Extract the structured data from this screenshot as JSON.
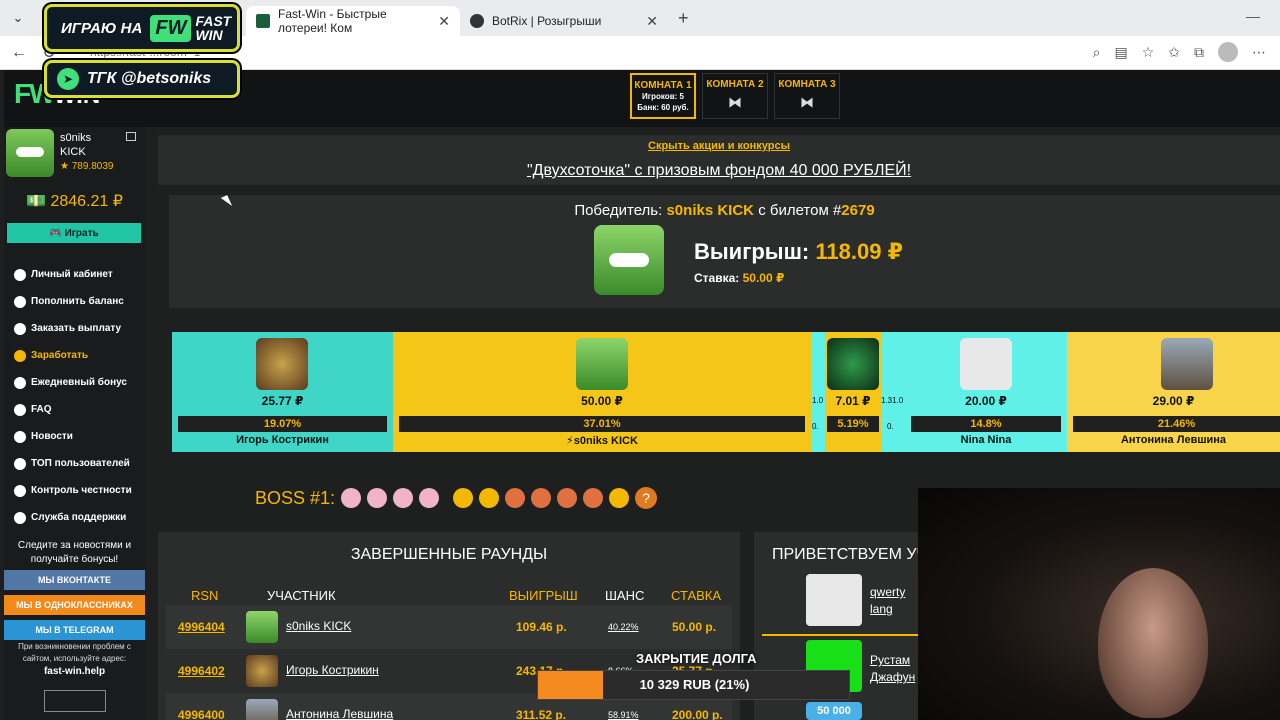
{
  "browser": {
    "tabs": [
      {
        "title": "Fast-Win - Быстрые лотереи! Ком",
        "active": true
      },
      {
        "title": "BotRix | Розыгрыши",
        "active": false
      }
    ],
    "url": "https://fast-win.help/?room=1",
    "url_visible": "https://fast-...room=1"
  },
  "overlay": {
    "promo1": {
      "text": "ИГРАЮ НА",
      "logo_fw": "FW",
      "logo_fast": "FAST",
      "logo_win": "WIN"
    },
    "promo2": {
      "text": "ТГК @betsoniks"
    }
  },
  "header": {
    "logo_fw": "FW",
    "logo_win": "WIN",
    "rooms": [
      {
        "name": "КОМНАТА 1",
        "players": "Игроков: 5",
        "bank": "Банк: 60 руб.",
        "active": true
      },
      {
        "name": "КОМНАТА 2",
        "icon": "ribbon-icon",
        "active": false
      },
      {
        "name": "КОМНАТА 3",
        "icon": "ribbon-icon",
        "active": false
      }
    ]
  },
  "sidebar": {
    "username_line1": "s0niks",
    "username_line2": "KICK",
    "rating": "★ 789.8039",
    "balance": "💵 2846.21 ₽",
    "play_button": "🎮 Играть",
    "menu": [
      {
        "label": "Личный кабинет",
        "icon": "briefcase-icon",
        "highlight": false
      },
      {
        "label": "Пополнить баланс",
        "icon": "plus-circle-icon",
        "highlight": false
      },
      {
        "label": "Заказать выплату",
        "icon": "download-circle-icon",
        "highlight": false
      },
      {
        "label": "Заработать",
        "icon": "money-icon",
        "highlight": true
      },
      {
        "label": "Ежедневный бонус",
        "icon": "gift-icon",
        "highlight": false
      },
      {
        "label": "FAQ",
        "icon": "question-icon",
        "highlight": false
      },
      {
        "label": "Новости",
        "icon": "bookmark-icon",
        "highlight": false
      },
      {
        "label": "ТОП пользователей",
        "icon": "trophy-icon",
        "highlight": false
      },
      {
        "label": "Контроль честности",
        "icon": "shuffle-icon",
        "highlight": false
      },
      {
        "label": "Служба поддержки",
        "icon": "lifebuoy-icon",
        "highlight": false
      }
    ],
    "follow_text_1": "Следите за новостями и",
    "follow_text_2": "получайте бонусы!",
    "social": {
      "vk": "МЫ ВКОНТАКТЕ",
      "ok": "МЫ В ОДНОКЛАССНИКАХ",
      "tg": "МЫ В TELEGRAM"
    },
    "problem_1": "При возникновении проблем с",
    "problem_2": "сайтом, используйте адрес:",
    "problem_url": "fast-win.help"
  },
  "main": {
    "hide_promos": "Скрыть акции и конкурсы",
    "promo_link": "\"Двухсоточка\" с призовым фондом 40 000 РУБЛЕЙ!",
    "winner": {
      "prefix": "Победитель:",
      "name": "s0niks KICK",
      "ticket_prefix": "с билетом #",
      "ticket": "2679",
      "win_label": "Выигрыш:",
      "win_amount": "118.09 ₽",
      "bet_label": "Ставка:",
      "bet_amount": "50.00 ₽"
    },
    "players": [
      {
        "amount": "25.77 ₽",
        "percent": "19.07%",
        "name": "Игорь Кострикин",
        "bg": "#3fd6c8"
      },
      {
        "amount": "50.00 ₽",
        "percent": "37.01%",
        "name": "⚡s0niks KICK",
        "bg": "#f5c518"
      },
      {
        "amount": "7.01 ₽",
        "percent": "5.19%",
        "name": "",
        "bg": "#f5c518"
      },
      {
        "amount": "20.00 ₽",
        "percent": "14.8%",
        "name": "Nina Nina",
        "bg": "#5ff0e8"
      },
      {
        "amount": "29.00 ₽",
        "percent": "21.46%",
        "name": "Антонина Левшина",
        "bg": "#f7d44a"
      }
    ],
    "small_labels": {
      "a": "1.0",
      "b": "0.",
      "c": "1.31.0",
      "d": "0.",
      "e": "0."
    },
    "boss_label": "BOSS #1:",
    "boss_help": "?",
    "rounds": {
      "title": "ЗАВЕРШЕННЫЕ РАУНДЫ",
      "headers": {
        "rsn": "RSN",
        "player": "УЧАСТНИК",
        "win": "ВЫИГРЫШ",
        "chance": "ШАНС",
        "bet": "СТАВКА"
      },
      "rows": [
        {
          "rsn": "4996404",
          "name": "s0niks KICK",
          "win": "109.46 р.",
          "chance": "40.22%",
          "bet": "50.00 р."
        },
        {
          "rsn": "4996402",
          "name": "Игорь Кострикин",
          "win": "243.17 р.",
          "chance": "8.66%",
          "bet": "25.77 р."
        },
        {
          "rsn": "4996400",
          "name": "Антонина Левшина",
          "win": "311.52 р.",
          "chance": "58.91%",
          "bet": "200.00 р."
        }
      ]
    },
    "welcome": {
      "title": "ПРИВЕТСТВУЕМ УЧ",
      "users": [
        {
          "line1": "qwerty",
          "line2": "lang"
        },
        {
          "line1": "Рустам",
          "line2": "Джафун"
        },
        {
          "line1": "",
          "line2": "",
          "badge": "50 000"
        }
      ]
    }
  },
  "stream": {
    "debt_label": "ЗАКРЫТИЕ ДОЛГА",
    "debt_text": "10 329 RUB (21%)",
    "debt_fraction": 0.21
  }
}
